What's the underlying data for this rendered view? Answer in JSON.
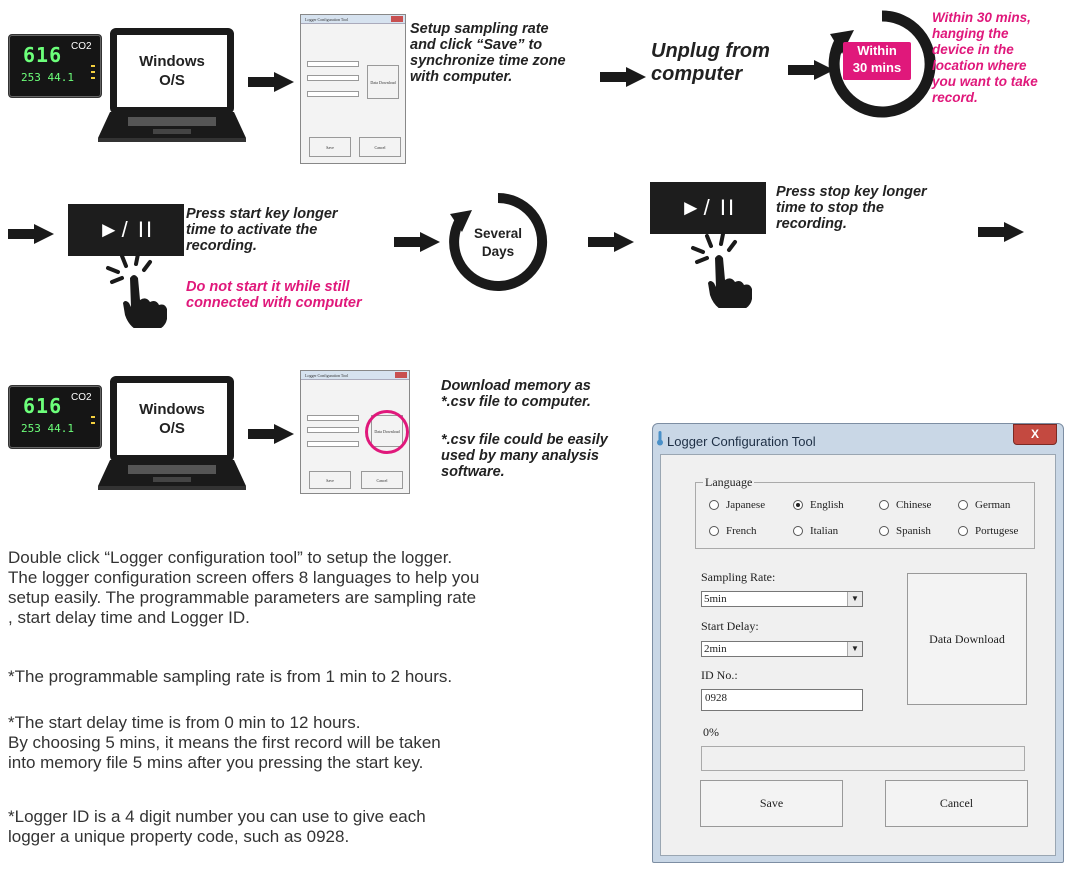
{
  "step1": {
    "os_label_line1": "Windows",
    "os_label_line2": "O/S",
    "caption_lines": [
      "Setup sampling rate",
      "and click “Save” to",
      "synchronize time zone",
      "with computer."
    ],
    "device": {
      "reading": "616",
      "unit": "CO2",
      "small": "253 44.1"
    }
  },
  "step2": {
    "caption_line1": "Unplug from",
    "caption_line2": "computer",
    "timer_line1": "Within",
    "timer_line2": "30 mins",
    "note_lines": [
      "Within 30 mins,",
      "hanging the",
      "device in the",
      "location where",
      "you want to take",
      "record."
    ]
  },
  "step3": {
    "play_label": "►/ II",
    "caption_lines": [
      "Press start key longer",
      "time to activate the",
      "recording."
    ],
    "warning_lines": [
      "Do not start it while still",
      "connected with computer"
    ],
    "days_line1": "Several",
    "days_line2": "Days",
    "stop_caption_lines": [
      "Press stop key longer",
      "time to stop the",
      "recording."
    ]
  },
  "step4": {
    "caption_lines": [
      "Download memory as",
      "*.csv file to computer."
    ],
    "caption2_lines": [
      "*.csv file could be easily",
      "used by many analysis",
      "software."
    ]
  },
  "description": {
    "p1_lines": [
      "Double click “Logger configuration tool” to setup the logger.",
      "The logger configuration screen offers 8 languages to help you",
      "setup easily. The programmable parameters are sampling rate",
      ", start delay time and Logger ID."
    ],
    "p2": "*The programmable sampling rate is from 1 min to 2 hours.",
    "p3_lines": [
      "*The start delay time is from 0 min to 12 hours.",
      "By choosing 5 mins, it means the first record will be taken",
      "into memory file 5 mins after you pressing the start key."
    ],
    "p4_lines": [
      "*Logger ID is a 4 digit number you can use to give each",
      "logger a unique property code, such as 0928."
    ]
  },
  "tool": {
    "title": "Logger Configuration Tool",
    "close": "X",
    "language_legend": "Language",
    "languages": [
      "Japanese",
      "English",
      "Chinese",
      "German",
      "French",
      "Italian",
      "Spanish",
      "Portugese"
    ],
    "selected_language": "English",
    "sampling_label": "Sampling Rate:",
    "sampling_value": "5min",
    "delay_label": "Start Delay:",
    "delay_value": "2min",
    "id_label": "ID No.:",
    "id_value": "0928",
    "progress_text": "0%",
    "download_btn": "Data Download",
    "save_btn": "Save",
    "cancel_btn": "Cancel"
  },
  "mini_tool": {
    "title": "Logger Configuration Tool",
    "download_btn": "Data Download",
    "save_btn": "Save",
    "cancel_btn": "Cancel",
    "id_value": "0928"
  },
  "colors": {
    "accent": "#e0187b",
    "dark": "#1a1a1a",
    "display": "#6cff7a"
  }
}
